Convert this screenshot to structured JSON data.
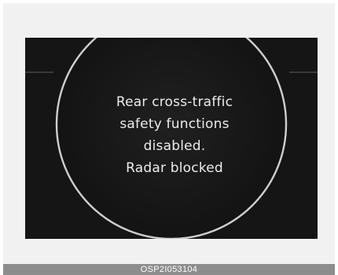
{
  "display": {
    "background_color": "#151515",
    "gauge_ring_color": "#cfcfcf",
    "message": {
      "lines": [
        "Rear cross-traffic",
        "safety functions",
        "disabled.",
        "Radar blocked"
      ],
      "text_color": "#ececec"
    }
  },
  "caption": {
    "code": "OSP2I053104",
    "bar_color": "#8d8d8d"
  }
}
